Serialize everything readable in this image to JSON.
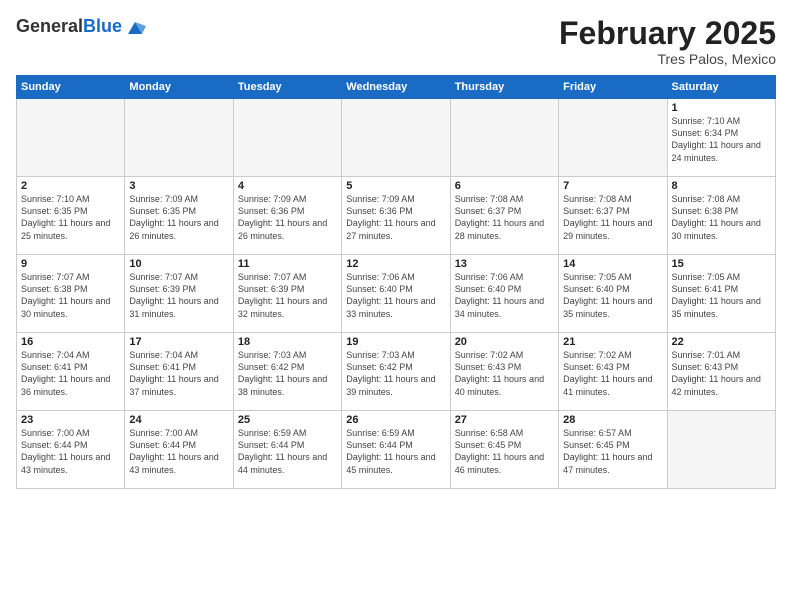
{
  "logo": {
    "general": "General",
    "blue": "Blue"
  },
  "header": {
    "title": "February 2025",
    "subtitle": "Tres Palos, Mexico"
  },
  "days_of_week": [
    "Sunday",
    "Monday",
    "Tuesday",
    "Wednesday",
    "Thursday",
    "Friday",
    "Saturday"
  ],
  "weeks": [
    [
      {
        "day": "",
        "info": ""
      },
      {
        "day": "",
        "info": ""
      },
      {
        "day": "",
        "info": ""
      },
      {
        "day": "",
        "info": ""
      },
      {
        "day": "",
        "info": ""
      },
      {
        "day": "",
        "info": ""
      },
      {
        "day": "1",
        "info": "Sunrise: 7:10 AM\nSunset: 6:34 PM\nDaylight: 11 hours and 24 minutes."
      }
    ],
    [
      {
        "day": "2",
        "info": "Sunrise: 7:10 AM\nSunset: 6:35 PM\nDaylight: 11 hours and 25 minutes."
      },
      {
        "day": "3",
        "info": "Sunrise: 7:09 AM\nSunset: 6:35 PM\nDaylight: 11 hours and 26 minutes."
      },
      {
        "day": "4",
        "info": "Sunrise: 7:09 AM\nSunset: 6:36 PM\nDaylight: 11 hours and 26 minutes."
      },
      {
        "day": "5",
        "info": "Sunrise: 7:09 AM\nSunset: 6:36 PM\nDaylight: 11 hours and 27 minutes."
      },
      {
        "day": "6",
        "info": "Sunrise: 7:08 AM\nSunset: 6:37 PM\nDaylight: 11 hours and 28 minutes."
      },
      {
        "day": "7",
        "info": "Sunrise: 7:08 AM\nSunset: 6:37 PM\nDaylight: 11 hours and 29 minutes."
      },
      {
        "day": "8",
        "info": "Sunrise: 7:08 AM\nSunset: 6:38 PM\nDaylight: 11 hours and 30 minutes."
      }
    ],
    [
      {
        "day": "9",
        "info": "Sunrise: 7:07 AM\nSunset: 6:38 PM\nDaylight: 11 hours and 30 minutes."
      },
      {
        "day": "10",
        "info": "Sunrise: 7:07 AM\nSunset: 6:39 PM\nDaylight: 11 hours and 31 minutes."
      },
      {
        "day": "11",
        "info": "Sunrise: 7:07 AM\nSunset: 6:39 PM\nDaylight: 11 hours and 32 minutes."
      },
      {
        "day": "12",
        "info": "Sunrise: 7:06 AM\nSunset: 6:40 PM\nDaylight: 11 hours and 33 minutes."
      },
      {
        "day": "13",
        "info": "Sunrise: 7:06 AM\nSunset: 6:40 PM\nDaylight: 11 hours and 34 minutes."
      },
      {
        "day": "14",
        "info": "Sunrise: 7:05 AM\nSunset: 6:40 PM\nDaylight: 11 hours and 35 minutes."
      },
      {
        "day": "15",
        "info": "Sunrise: 7:05 AM\nSunset: 6:41 PM\nDaylight: 11 hours and 35 minutes."
      }
    ],
    [
      {
        "day": "16",
        "info": "Sunrise: 7:04 AM\nSunset: 6:41 PM\nDaylight: 11 hours and 36 minutes."
      },
      {
        "day": "17",
        "info": "Sunrise: 7:04 AM\nSunset: 6:41 PM\nDaylight: 11 hours and 37 minutes."
      },
      {
        "day": "18",
        "info": "Sunrise: 7:03 AM\nSunset: 6:42 PM\nDaylight: 11 hours and 38 minutes."
      },
      {
        "day": "19",
        "info": "Sunrise: 7:03 AM\nSunset: 6:42 PM\nDaylight: 11 hours and 39 minutes."
      },
      {
        "day": "20",
        "info": "Sunrise: 7:02 AM\nSunset: 6:43 PM\nDaylight: 11 hours and 40 minutes."
      },
      {
        "day": "21",
        "info": "Sunrise: 7:02 AM\nSunset: 6:43 PM\nDaylight: 11 hours and 41 minutes."
      },
      {
        "day": "22",
        "info": "Sunrise: 7:01 AM\nSunset: 6:43 PM\nDaylight: 11 hours and 42 minutes."
      }
    ],
    [
      {
        "day": "23",
        "info": "Sunrise: 7:00 AM\nSunset: 6:44 PM\nDaylight: 11 hours and 43 minutes."
      },
      {
        "day": "24",
        "info": "Sunrise: 7:00 AM\nSunset: 6:44 PM\nDaylight: 11 hours and 43 minutes."
      },
      {
        "day": "25",
        "info": "Sunrise: 6:59 AM\nSunset: 6:44 PM\nDaylight: 11 hours and 44 minutes."
      },
      {
        "day": "26",
        "info": "Sunrise: 6:59 AM\nSunset: 6:44 PM\nDaylight: 11 hours and 45 minutes."
      },
      {
        "day": "27",
        "info": "Sunrise: 6:58 AM\nSunset: 6:45 PM\nDaylight: 11 hours and 46 minutes."
      },
      {
        "day": "28",
        "info": "Sunrise: 6:57 AM\nSunset: 6:45 PM\nDaylight: 11 hours and 47 minutes."
      },
      {
        "day": "",
        "info": ""
      }
    ]
  ]
}
